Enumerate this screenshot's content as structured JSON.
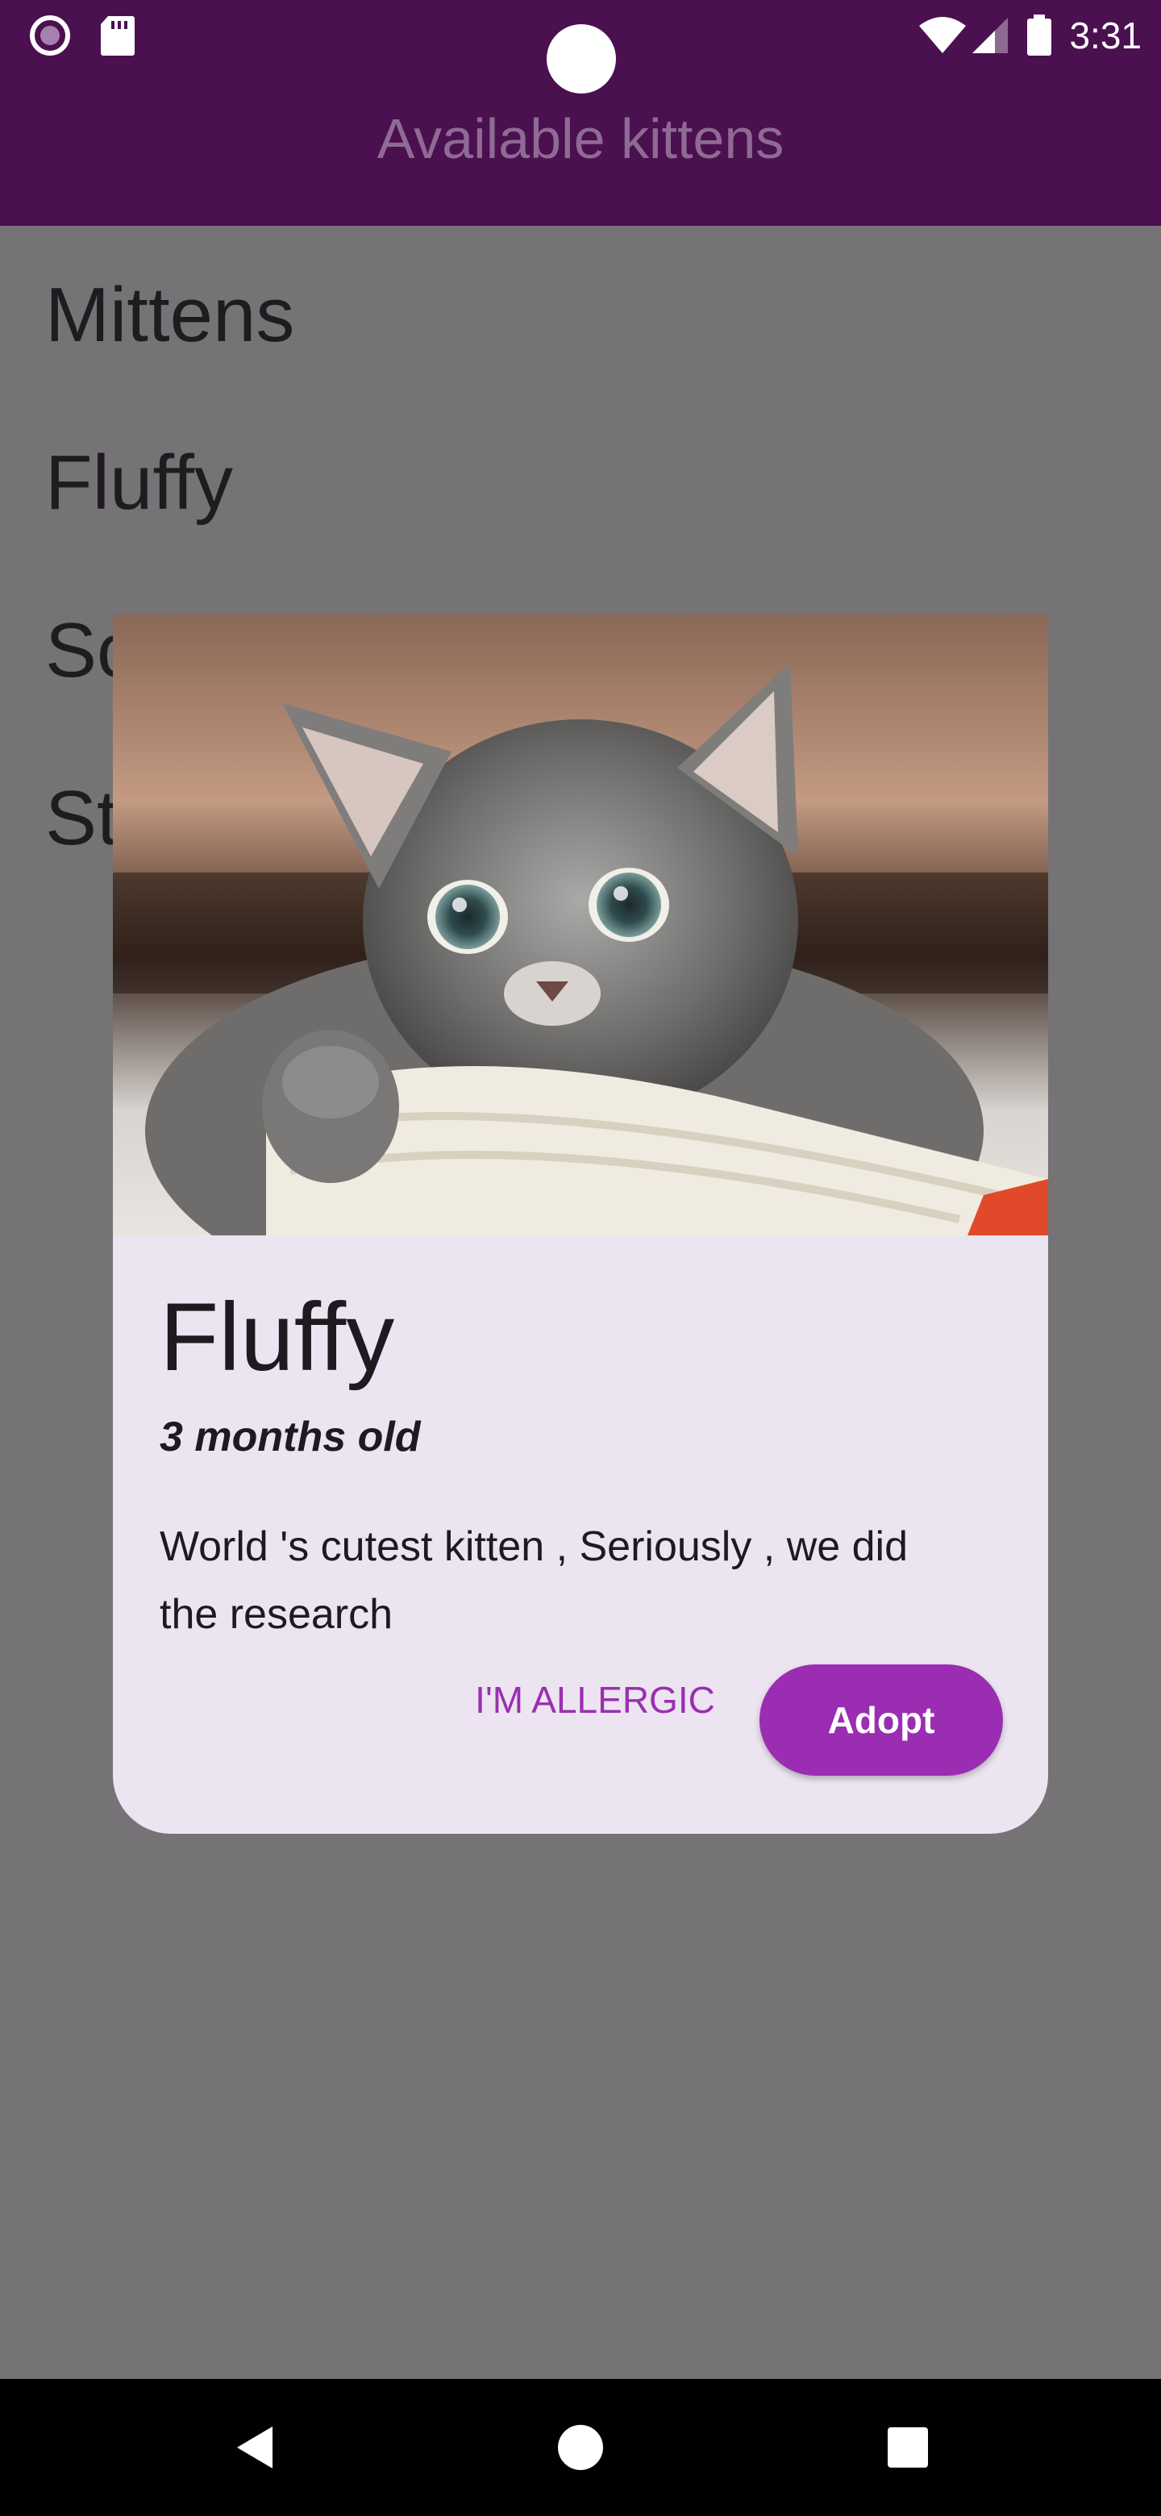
{
  "status_bar": {
    "time": "3:31",
    "icons": [
      "radio-icon",
      "sd-card-icon",
      "wifi-icon",
      "signal-icon",
      "battery-icon"
    ]
  },
  "app_bar": {
    "title": "Available kittens",
    "background": "#4a104f"
  },
  "kitten_list": {
    "items": [
      "Mittens",
      "Fluffy",
      "Sc",
      "St"
    ]
  },
  "dialog": {
    "image_icon": "kitten-photo",
    "name": "Fluffy",
    "age": "3 months old",
    "description": "World 's cutest kitten , Seriously , we did the research",
    "secondary_button": "I'M ALLERGIC",
    "primary_button": "Adopt",
    "accent": "#9b2db3",
    "background": "#ece5f1"
  },
  "nav_bar": {
    "icons": [
      "back-icon",
      "home-icon",
      "recents-icon"
    ]
  }
}
